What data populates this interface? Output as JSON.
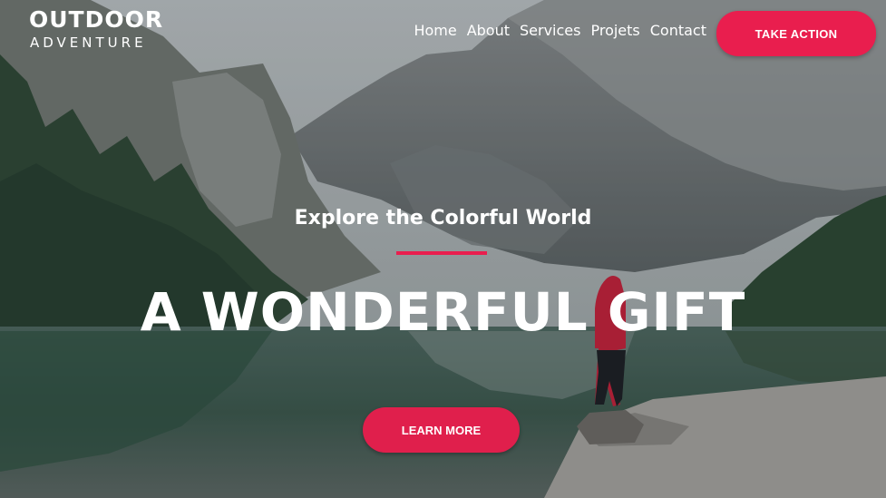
{
  "brand": {
    "line1": "OUTDOOR",
    "line2": "ADVENTURE"
  },
  "nav": {
    "items": [
      {
        "label": "Home"
      },
      {
        "label": "About"
      },
      {
        "label": "Services"
      },
      {
        "label": "Projets"
      },
      {
        "label": "Contact"
      }
    ],
    "cta_label": "TAKE ACTION"
  },
  "hero": {
    "subtitle": "Explore the Colorful World",
    "headline": "A WONDERFUL GIFT",
    "cta_label": "LEARN MORE",
    "background": "mountain-lake-photo"
  },
  "colors": {
    "accent": "#e91e4e",
    "text": "#ffffff"
  }
}
